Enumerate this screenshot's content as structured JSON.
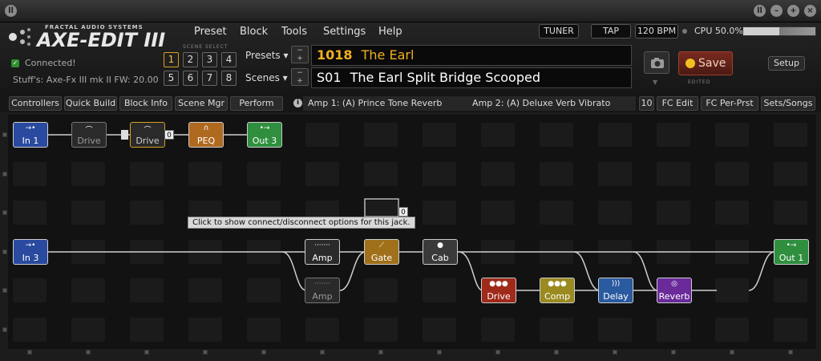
{
  "app": {
    "logo_top": "FRACTAL AUDIO SYSTEMS",
    "logo": "AXE-EDIT III"
  },
  "menu": [
    "Preset",
    "Block",
    "Tools",
    "Settings",
    "Help"
  ],
  "top_controls": {
    "tuner": "TUNER",
    "tap": "TAP",
    "bpm": "120 BPM",
    "cpu": "CPU 50.0%",
    "cpu_percent": 50
  },
  "status": {
    "connected": "Connected!",
    "device": "Stuff's: Axe-Fx III mk II FW: 20.00"
  },
  "scene_select": {
    "label": "SCENE SELECT",
    "buttons": [
      "1",
      "2",
      "3",
      "4",
      "5",
      "6",
      "7",
      "8"
    ],
    "active": "1"
  },
  "preset": {
    "label": "Presets",
    "number": "1018",
    "name": "The Earl"
  },
  "scene": {
    "label": "Scenes",
    "number": "S01",
    "name": "The Earl Split Bridge Scooped"
  },
  "save": {
    "label": "Save",
    "edited": "EDITED"
  },
  "setup": "Setup",
  "toolbar": {
    "buttons": [
      "Controllers",
      "Quick Build",
      "Block Info",
      "Scene Mgr",
      "Perform"
    ],
    "amp1": "Amp 1: (A) Prince Tone Reverb",
    "amp2": "Amp 2: (A) Deluxe Verb Vibrato",
    "right_buttons": [
      "10",
      "FC Edit",
      "FC Per-Prst",
      "Sets/Songs"
    ]
  },
  "tooltip": "Click to show connect/disconnect options for this jack.",
  "badges": {
    "drive_jack": "0",
    "empty_jack": "0"
  },
  "blocks": {
    "in1": "In 1",
    "drive_bypassed": "Drive",
    "drive": "Drive",
    "peq": "PEQ",
    "out3": "Out 3",
    "in3": "In 3",
    "amp": "Amp",
    "amp_bypassed": "Amp",
    "gate": "Gate",
    "cab": "Cab",
    "drive2": "Drive",
    "comp": "Comp",
    "delay": "Delay",
    "reverb": "Reverb",
    "out1": "Out 1"
  },
  "colors": {
    "in": "#2a4aa0",
    "out": "#2f8f3f",
    "drive": "#a02a1a",
    "peq": "#b06a20",
    "gate": "#a0701a",
    "comp": "#9a8a20",
    "delay": "#2a5aa0",
    "reverb": "#6a2a9a",
    "accent": "#f0b020"
  }
}
